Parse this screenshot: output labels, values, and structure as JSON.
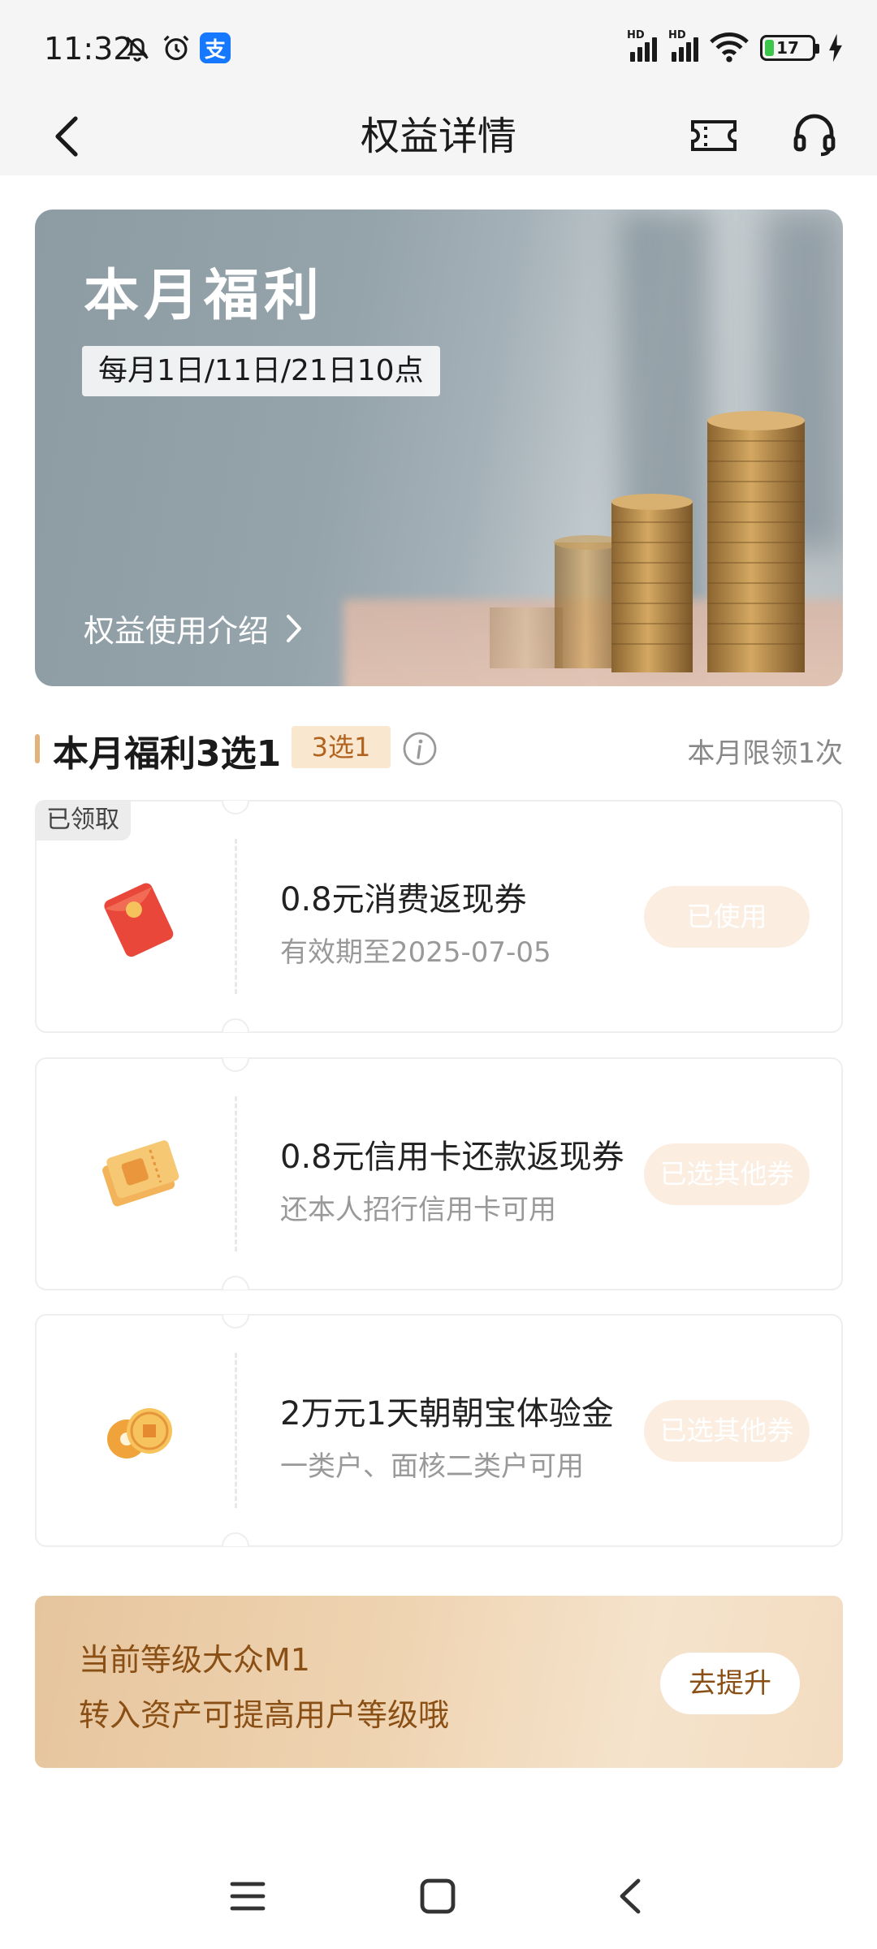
{
  "status_bar": {
    "time": "11:32",
    "signal_label_1": "HD",
    "signal_label_2": "HD",
    "battery": "17",
    "icons": [
      "silent-bell-icon",
      "alarm-icon",
      "alipay-icon",
      "signal-icon",
      "signal-icon",
      "wifi-icon",
      "battery-icon",
      "charging-icon"
    ]
  },
  "header": {
    "title": "权益详情",
    "icons": [
      "back-arrow-icon",
      "ticket-icon",
      "headset-icon"
    ]
  },
  "banner": {
    "title": "本月福利",
    "subtitle": "每月1日/11日/21日10点",
    "link": "权益使用介绍"
  },
  "section": {
    "title": "本月福利3选1",
    "badge": "3选1",
    "note": "本月限领1次"
  },
  "coupons": [
    {
      "tag": "已领取",
      "name": "0.8元消费返现券",
      "desc": "有效期至2025-07-05",
      "button": "已使用",
      "icon": "red-envelope-icon"
    },
    {
      "tag": "",
      "name": "0.8元信用卡还款返现券",
      "desc": "还本人招行信用卡可用",
      "button": "已选其他券",
      "icon": "ticket-coupon-icon"
    },
    {
      "tag": "",
      "name": "2万元1天朝朝宝体验金",
      "desc": "一类户、面核二类户可用",
      "button": "已选其他券",
      "icon": "gold-coins-icon"
    }
  ],
  "level": {
    "line1": "当前等级大众M1",
    "line2": "转入资产可提高用户等级哦",
    "button": "去提升"
  },
  "colors": {
    "accent": "#e3b27a",
    "badge_bg": "#fae7cf",
    "badge_text": "#b0641f",
    "level_text": "#8a4f15",
    "disabled_btn": "#fbeee1"
  }
}
